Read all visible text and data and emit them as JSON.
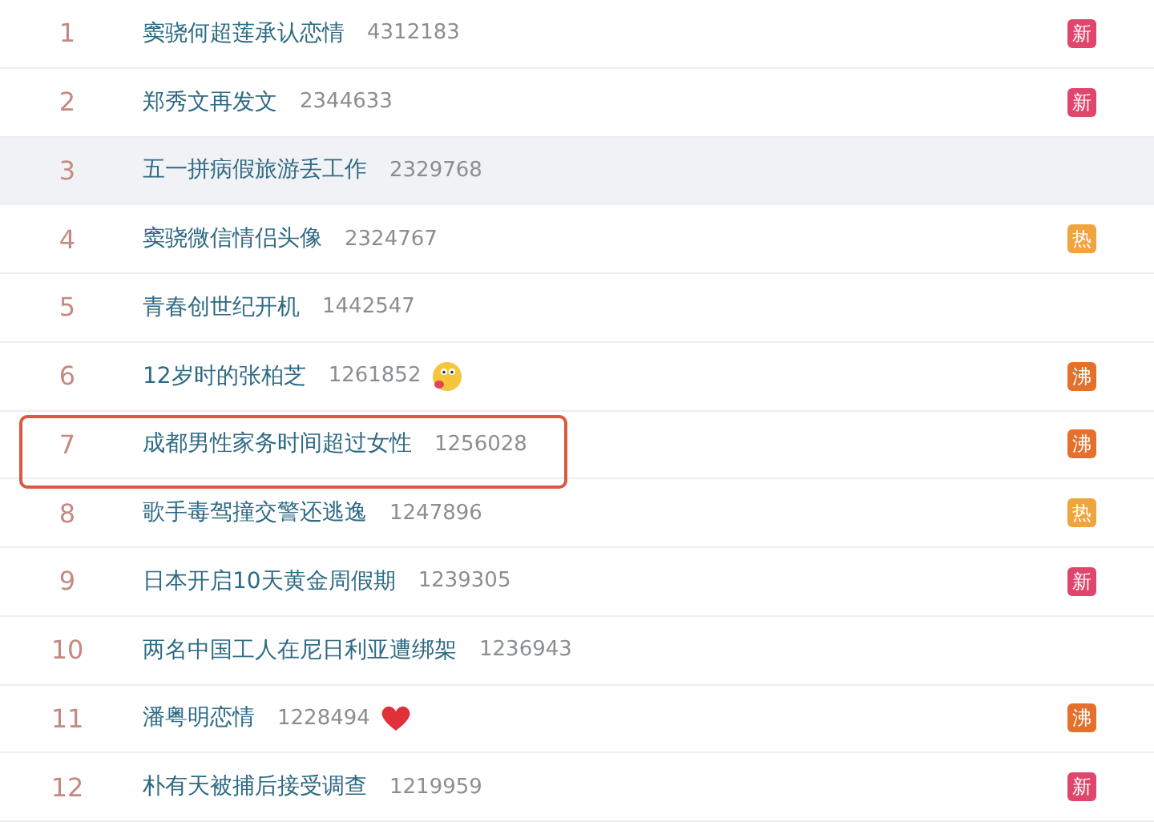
{
  "rows": [
    {
      "rank": "1",
      "title": "窦骁何超莲承认恋情",
      "count": "4312183",
      "badge": "新",
      "color": "#e0466c",
      "selected": false,
      "framed": false
    },
    {
      "rank": "2",
      "title": "郑秀文再发文",
      "count": "2344633",
      "badge": "新",
      "color": "#e0466c",
      "selected": false,
      "framed": false
    },
    {
      "rank": "3",
      "title": "五一拼病假旅游丢工作",
      "count": "2329768",
      "selected": true,
      "framed": false
    },
    {
      "rank": "4",
      "title": "窦骁微信情侣头像",
      "count": "2324767",
      "badge": "热",
      "color": "#f0a43e",
      "selected": false,
      "framed": false
    },
    {
      "rank": "5",
      "title": "青春创世纪开机",
      "count": "1442547",
      "selected": false,
      "framed": false
    },
    {
      "rank": "6",
      "title": "12岁时的张柏芝",
      "count": "1261852",
      "kind": "face",
      "badge": "沸",
      "color": "#e4702c",
      "selected": false,
      "framed": false
    },
    {
      "rank": "7",
      "title": "成都男性家务时间超过女性",
      "count": "1256028",
      "badge": "沸",
      "color": "#e4702c",
      "selected": false,
      "framed": true
    },
    {
      "rank": "8",
      "title": "歌手毒驾撞交警还逃逸",
      "count": "1247896",
      "badge": "热",
      "color": "#f0a43e",
      "selected": false,
      "framed": false
    },
    {
      "rank": "9",
      "title": "日本开启10天黄金周假期",
      "count": "1239305",
      "badge": "新",
      "color": "#e0466c",
      "selected": false,
      "framed": false
    },
    {
      "rank": "10",
      "title": "两名中国工人在尼日利亚遭绑架",
      "count": "1236943",
      "selected": false,
      "framed": false
    },
    {
      "rank": "11",
      "title": "潘粤明恋情",
      "count": "1228494",
      "kind": "heart",
      "badge": "沸",
      "color": "#e4702c",
      "selected": false,
      "framed": false
    },
    {
      "rank": "12",
      "title": "朴有天被捕后接受调查",
      "count": "1219959",
      "badge": "新",
      "color": "#e0466c",
      "selected": false,
      "framed": false
    }
  ]
}
